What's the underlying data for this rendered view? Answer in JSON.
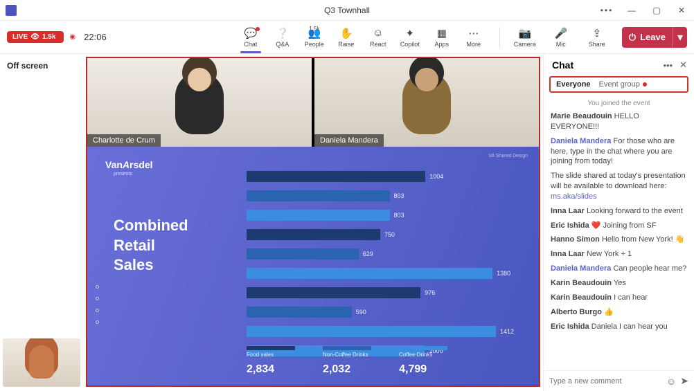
{
  "window": {
    "title": "Q3 Townhall"
  },
  "live": {
    "label": "LIVE",
    "viewers": "1.5k",
    "timer": "22:06"
  },
  "tools": [
    {
      "id": "chat",
      "label": "Chat",
      "selected": true,
      "dot": true
    },
    {
      "id": "qa",
      "label": "Q&A"
    },
    {
      "id": "people",
      "label": "People",
      "sub": "1.5k"
    },
    {
      "id": "raise",
      "label": "Raise"
    },
    {
      "id": "react",
      "label": "React"
    },
    {
      "id": "copilot",
      "label": "Copilot"
    },
    {
      "id": "apps",
      "label": "Apps"
    },
    {
      "id": "more",
      "label": "More"
    }
  ],
  "controls": {
    "camera": "Camera",
    "mic": "Mic",
    "share": "Share",
    "leave": "Leave"
  },
  "offscreen": "Off screen",
  "participants": [
    {
      "name": "Charlotte de Crum"
    },
    {
      "name": "Daniela Mandera"
    }
  ],
  "slide": {
    "brand": "VanArsdel",
    "presents": "presents",
    "heading": [
      "Combined",
      "Retail",
      "Sales"
    ],
    "legend": [
      "Food sales",
      "Non-Coffee Drinks",
      "Coffee Drinks"
    ],
    "totals": [
      "2,834",
      "2,032",
      "4,799"
    ],
    "corner": "VA Shared Design"
  },
  "chart_data": {
    "type": "bar",
    "orientation": "horizontal",
    "series": [
      {
        "name": "Food sales",
        "color": "#1d3a6e"
      },
      {
        "name": "Non-Coffee Drinks",
        "color": "#2a63b0"
      },
      {
        "name": "Coffee Drinks",
        "color": "#3a8de0"
      }
    ],
    "rows": [
      {
        "series": 0,
        "value": 1004
      },
      {
        "series": 1,
        "value": 803
      },
      {
        "series": 2,
        "value": 803
      },
      {
        "series": 0,
        "value": 750
      },
      {
        "series": 1,
        "value": 629
      },
      {
        "series": 2,
        "value": 1380
      },
      {
        "series": 0,
        "value": 976
      },
      {
        "series": 1,
        "value": 590
      },
      {
        "series": 2,
        "value": 1412
      },
      {
        "series": 2,
        "value": 1000
      }
    ],
    "xlim": [
      0,
      1500
    ]
  },
  "chat": {
    "title": "Chat",
    "tabs": {
      "active": "Everyone",
      "other": "Event group"
    },
    "joined": "You joined the event",
    "messages": [
      {
        "name": "Marie Beaudouin",
        "text": "HELLO EVERYONE!!!"
      },
      {
        "name": "Daniela Mandera",
        "link": true,
        "text": "For those who are here, type in the chat where you are joining from today!"
      },
      {
        "text": "The slide shared at today's presentation will be available to download here: ",
        "linkText": "ms.aka/slides"
      },
      {
        "name": "Inna Laar",
        "text": "Looking forward to the event"
      },
      {
        "name": "Eric Ishida",
        "text": "❤️  Joining from SF"
      },
      {
        "name": "Hanno Simon",
        "text": "Hello from New York!  👋"
      },
      {
        "name": "Inna Laar",
        "text": "New York + 1"
      },
      {
        "name": "Daniela Mandera",
        "link": true,
        "text": "Can people hear me?"
      },
      {
        "name": "Karin Beaudouin",
        "text": "Yes"
      },
      {
        "name": "Karin Beaudouin",
        "text": "I can hear"
      },
      {
        "name": "Alberto Burgo",
        "text": "👍"
      },
      {
        "name": "Eric Ishida",
        "text": "Daniela I can hear you"
      }
    ],
    "placeholder": "Type a new comment"
  }
}
